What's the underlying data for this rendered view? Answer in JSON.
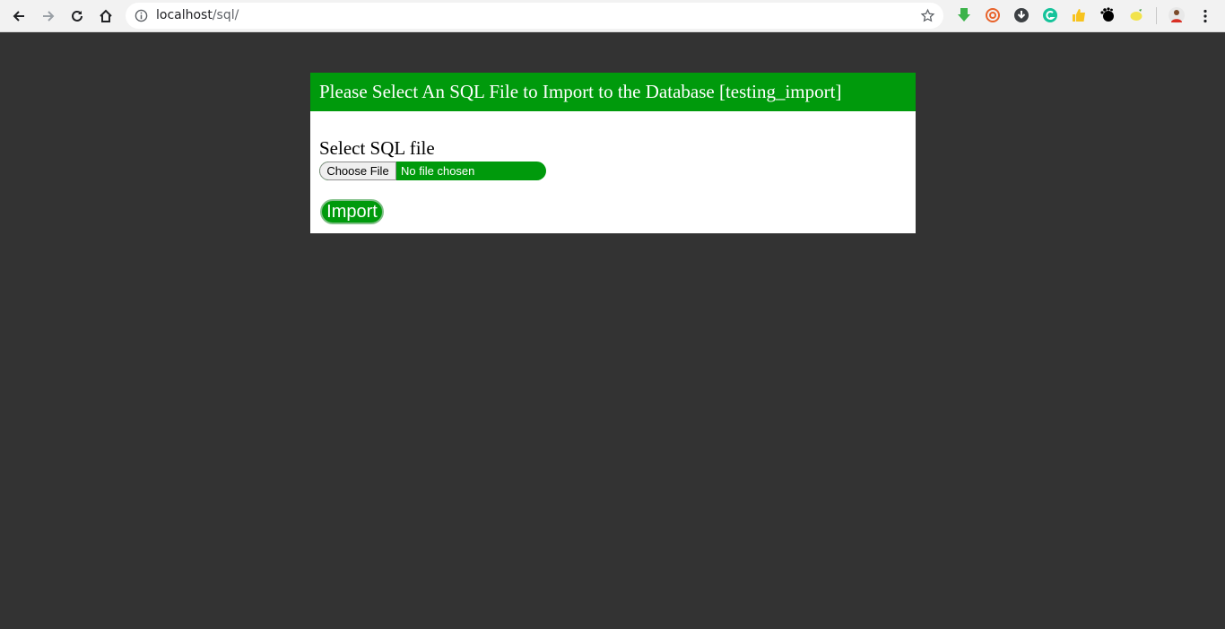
{
  "browser": {
    "url_host": "localhost",
    "url_path": "/sql/",
    "nav_icons": [
      "back-icon",
      "forward-icon",
      "reload-icon",
      "home-icon"
    ],
    "extension_icons": [
      "download-arrow-icon",
      "at-sign-icon",
      "download-circle-icon",
      "grammarly-icon",
      "thumbs-up-icon",
      "gnome-icon",
      "lemon-icon",
      "profile-avatar-icon"
    ]
  },
  "panel": {
    "title": "Please Select An SQL File to Import to the Database [testing_import]",
    "field_label": "Select SQL file",
    "choose_file_label": "Choose File",
    "file_status": "No file chosen",
    "import_label": "Import"
  },
  "colors": {
    "background": "#333333",
    "accent_green": "#009a0c",
    "panel": "#ffffff"
  }
}
